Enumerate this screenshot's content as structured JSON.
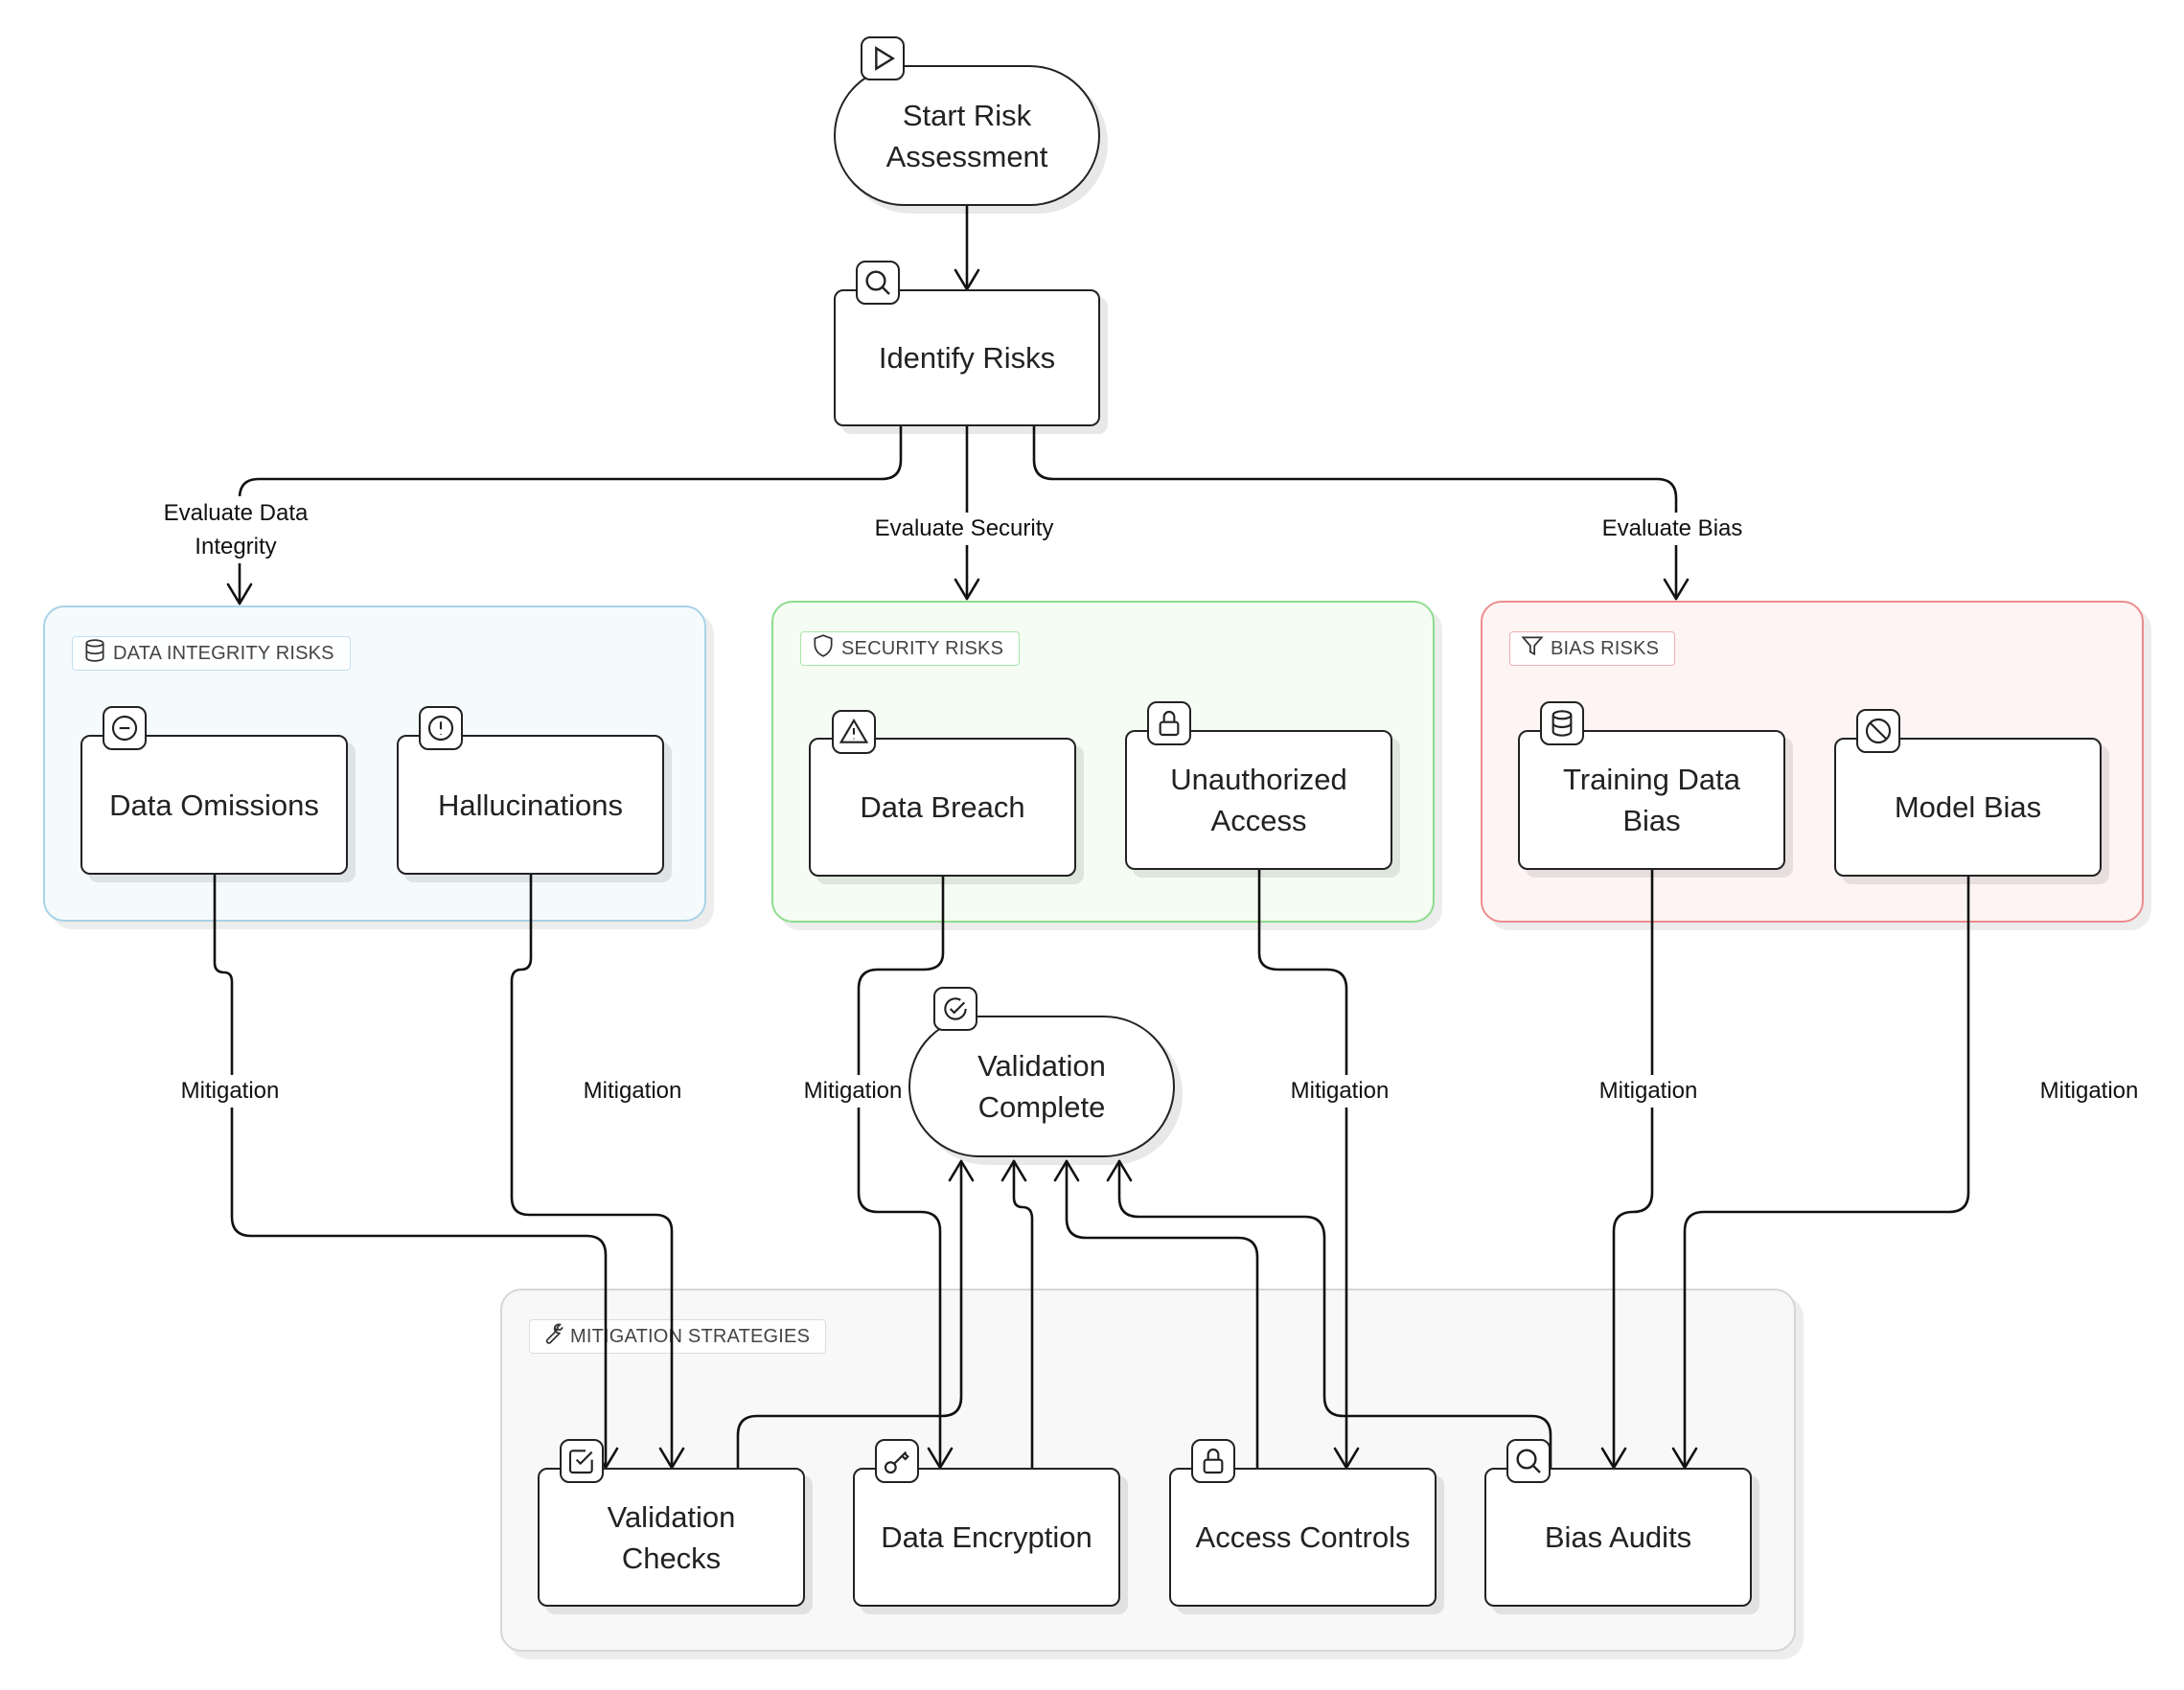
{
  "nodes": {
    "start": {
      "label": "Start Risk Assessment",
      "icon": "play-icon"
    },
    "identify": {
      "label": "Identify Risks",
      "icon": "search-icon"
    },
    "data_omissions": {
      "label": "Data Omissions",
      "icon": "minus-circle-icon"
    },
    "hallucinations": {
      "label": "Hallucinations",
      "icon": "alert-circle-icon"
    },
    "data_breach": {
      "label": "Data Breach",
      "icon": "warning-triangle-icon"
    },
    "unauthorized_access": {
      "label": "Unauthorized Access",
      "icon": "lock-icon"
    },
    "training_data_bias": {
      "label": "Training Data Bias",
      "icon": "database-icon"
    },
    "model_bias": {
      "label": "Model Bias",
      "icon": "ban-icon"
    },
    "validation_complete": {
      "label": "Validation Complete",
      "icon": "check-circle-icon"
    },
    "validation_checks": {
      "label": "Validation Checks",
      "icon": "checkbox-icon"
    },
    "data_encryption": {
      "label": "Data Encryption",
      "icon": "key-icon"
    },
    "access_controls": {
      "label": "Access Controls",
      "icon": "lock-icon"
    },
    "bias_audits": {
      "label": "Bias Audits",
      "icon": "search-icon"
    }
  },
  "groups": {
    "data_integrity": {
      "label": "DATA INTEGRITY RISKS",
      "icon": "database-icon",
      "border": "#a8d3e6",
      "fill": "#f5fafd"
    },
    "security": {
      "label": "SECURITY RISKS",
      "icon": "shield-icon",
      "border": "#8fdc8f",
      "fill": "#f4fcf3"
    },
    "bias": {
      "label": "BIAS RISKS",
      "icon": "filter-icon",
      "border": "#ec8d8d",
      "fill": "#fef4f4"
    },
    "mitigation": {
      "label": "MITIGATION STRATEGIES",
      "icon": "wrench-icon",
      "border": "#d6d6d6",
      "fill": "#f8f8f8"
    }
  },
  "edge_labels": {
    "eval_data_integrity": "Evaluate Data\nIntegrity",
    "eval_security": "Evaluate Security",
    "eval_bias": "Evaluate Bias",
    "mitigation": "Mitigation"
  },
  "edges": [
    {
      "from": "Start Risk Assessment",
      "to": "Identify Risks",
      "label": ""
    },
    {
      "from": "Identify Risks",
      "to": "DATA INTEGRITY RISKS",
      "label": "Evaluate Data Integrity"
    },
    {
      "from": "Identify Risks",
      "to": "SECURITY RISKS",
      "label": "Evaluate Security"
    },
    {
      "from": "Identify Risks",
      "to": "BIAS RISKS",
      "label": "Evaluate Bias"
    },
    {
      "from": "Data Omissions",
      "to": "Validation Checks",
      "label": "Mitigation"
    },
    {
      "from": "Hallucinations",
      "to": "Validation Checks",
      "label": "Mitigation"
    },
    {
      "from": "Data Breach",
      "to": "Data Encryption",
      "label": "Mitigation"
    },
    {
      "from": "Unauthorized Access",
      "to": "Access Controls",
      "label": "Mitigation"
    },
    {
      "from": "Training Data Bias",
      "to": "Bias Audits",
      "label": "Mitigation"
    },
    {
      "from": "Model Bias",
      "to": "Bias Audits",
      "label": "Mitigation"
    },
    {
      "from": "Validation Checks",
      "to": "Validation Complete",
      "label": ""
    },
    {
      "from": "Data Encryption",
      "to": "Validation Complete",
      "label": ""
    },
    {
      "from": "Access Controls",
      "to": "Validation Complete",
      "label": ""
    },
    {
      "from": "Bias Audits",
      "to": "Validation Complete",
      "label": ""
    }
  ]
}
